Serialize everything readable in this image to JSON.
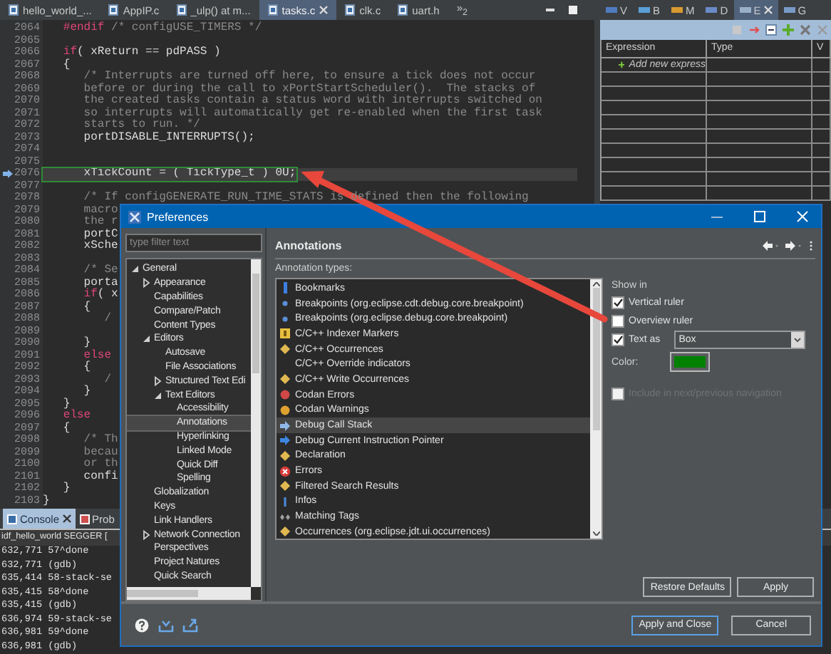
{
  "editor": {
    "tabs": [
      {
        "label": "hello_world_...",
        "selected": false
      },
      {
        "label": "AppIP.c",
        "selected": false
      },
      {
        "label": "_ulp() at m...",
        "selected": false
      },
      {
        "label": "tasks.c",
        "selected": true
      },
      {
        "label": "clk.c",
        "selected": false
      },
      {
        "label": "uart.h",
        "selected": false
      }
    ],
    "overflow": "»$_{2}$",
    "lines": [
      {
        "number": "2064",
        "current": false,
        "segments": [
          {
            "kind": "keyword",
            "text": "   #endif"
          },
          {
            "kind": "comment",
            "text": " /* configUSE_TIMERS */"
          }
        ]
      },
      {
        "number": "2065",
        "current": false
      },
      {
        "number": "2066",
        "current": false,
        "segments": [
          {
            "kind": "keyword",
            "text": "   if"
          },
          {
            "kind": "code",
            "text": "( xReturn == pdPASS )"
          }
        ]
      },
      {
        "number": "2067",
        "current": false,
        "segments": [
          {
            "kind": "code",
            "text": "   {"
          }
        ]
      },
      {
        "number": "2068",
        "current": false,
        "segments": [
          {
            "kind": "comment",
            "text": "      /* Interrupts are turned off here, to ensure a tick does not occur"
          }
        ]
      },
      {
        "number": "2069",
        "current": false,
        "segments": [
          {
            "kind": "comment",
            "text": "      before or during the call to xPortStartScheduler().  The stacks of"
          }
        ]
      },
      {
        "number": "2070",
        "current": false,
        "segments": [
          {
            "kind": "comment",
            "text": "      the created tasks contain a status word with interrupts switched on"
          }
        ]
      },
      {
        "number": "2071",
        "current": false,
        "segments": [
          {
            "kind": "comment",
            "text": "      so interrupts will automatically get re-enabled when the first task"
          }
        ]
      },
      {
        "number": "2072",
        "current": false,
        "segments": [
          {
            "kind": "comment",
            "text": "      starts to run. */"
          }
        ]
      },
      {
        "number": "2073",
        "current": false,
        "segments": [
          {
            "kind": "code",
            "text": "      portDISABLE_INTERRUPTS();"
          }
        ]
      },
      {
        "number": "2074",
        "current": false
      },
      {
        "number": "2075",
        "current": false
      },
      {
        "number": "2076",
        "current": true,
        "segments": [
          {
            "kind": "code",
            "text": "      xTickCount = ( TickType_t ) 0U;"
          }
        ]
      },
      {
        "number": "2077",
        "current": false
      },
      {
        "number": "2078",
        "current": false,
        "segments": [
          {
            "kind": "comment",
            "text": "      /* If configGENERATE_RUN_TIME_STATS is defined then the following"
          }
        ]
      },
      {
        "number": "2079",
        "current": false,
        "segments": [
          {
            "kind": "comment",
            "text": "      macro"
          }
        ]
      },
      {
        "number": "2080",
        "current": false,
        "segments": [
          {
            "kind": "comment",
            "text": "      the r"
          }
        ]
      },
      {
        "number": "2081",
        "current": false,
        "segments": [
          {
            "kind": "code",
            "text": "      portC"
          }
        ]
      },
      {
        "number": "2082",
        "current": false,
        "segments": [
          {
            "kind": "code",
            "text": "      xSche"
          }
        ]
      },
      {
        "number": "2083",
        "current": false
      },
      {
        "number": "2084",
        "current": false,
        "segments": [
          {
            "kind": "comment",
            "text": "      /* Se"
          }
        ]
      },
      {
        "number": "2085",
        "current": false,
        "segments": [
          {
            "kind": "code",
            "text": "      porta"
          }
        ]
      },
      {
        "number": "2086",
        "current": false,
        "segments": [
          {
            "kind": "keyword",
            "text": "      if"
          },
          {
            "kind": "code",
            "text": "( x"
          }
        ]
      },
      {
        "number": "2087",
        "current": false,
        "segments": [
          {
            "kind": "code",
            "text": "      {"
          }
        ]
      },
      {
        "number": "2088",
        "current": false,
        "segments": [
          {
            "kind": "comment",
            "text": "         /"
          }
        ]
      },
      {
        "number": "2089",
        "current": false
      },
      {
        "number": "2090",
        "current": false,
        "segments": [
          {
            "kind": "code",
            "text": "      }"
          }
        ]
      },
      {
        "number": "2091",
        "current": false,
        "segments": [
          {
            "kind": "keyword",
            "text": "      else"
          }
        ]
      },
      {
        "number": "2092",
        "current": false,
        "segments": [
          {
            "kind": "code",
            "text": "      {"
          }
        ]
      },
      {
        "number": "2093",
        "current": false,
        "segments": [
          {
            "kind": "comment",
            "text": "         /"
          }
        ]
      },
      {
        "number": "2094",
        "current": false,
        "segments": [
          {
            "kind": "code",
            "text": "      }"
          }
        ]
      },
      {
        "number": "2095",
        "current": false,
        "segments": [
          {
            "kind": "code",
            "text": "   }"
          }
        ]
      },
      {
        "number": "2096",
        "current": false,
        "segments": [
          {
            "kind": "keyword",
            "text": "   else"
          }
        ]
      },
      {
        "number": "2097",
        "current": false,
        "segments": [
          {
            "kind": "code",
            "text": "   {"
          }
        ]
      },
      {
        "number": "2098",
        "current": false,
        "segments": [
          {
            "kind": "comment",
            "text": "      /* Th"
          }
        ]
      },
      {
        "number": "2099",
        "current": false,
        "segments": [
          {
            "kind": "comment",
            "text": "      becau"
          }
        ]
      },
      {
        "number": "2100",
        "current": false,
        "segments": [
          {
            "kind": "comment",
            "text": "      or th"
          }
        ]
      },
      {
        "number": "2101",
        "current": false,
        "segments": [
          {
            "kind": "code",
            "text": "      confi"
          }
        ]
      },
      {
        "number": "2102",
        "current": false,
        "segments": [
          {
            "kind": "code",
            "text": "   }"
          }
        ]
      },
      {
        "number": "2103",
        "current": false,
        "segments": [
          {
            "kind": "code",
            "text": "}"
          }
        ]
      }
    ]
  },
  "watch": {
    "tabs": [
      {
        "label": "V",
        "selected": false
      },
      {
        "label": "B",
        "selected": false
      },
      {
        "label": "M",
        "selected": false
      },
      {
        "label": "D",
        "selected": false
      },
      {
        "label": "E",
        "selected": true
      },
      {
        "label": "G",
        "selected": false
      }
    ],
    "columns": [
      "Expression",
      "Type",
      "V"
    ],
    "add_row": "Add new express"
  },
  "console": {
    "tabs": [
      {
        "label": "Console",
        "selected": true
      },
      {
        "label": "Prob",
        "selected": false
      }
    ],
    "launch": "idf_hello_world SEGGER [",
    "lines": [
      "632,771 57^done",
      "632,771 (gdb)",
      "635,414 58-stack-se",
      "635,415 58^done",
      "635,415 (gdb)",
      "636,974 59-stack-se",
      "636,981 59^done",
      "636,981 (gdb)"
    ]
  },
  "dialog": {
    "title": "Preferences",
    "filter": {
      "placeholder": "type filter text"
    },
    "tree": [
      {
        "label": "General",
        "expanded": true,
        "selected": false,
        "children": [
          {
            "label": "Appearance",
            "expanded": false,
            "selected": false
          },
          {
            "label": "Capabilities",
            "selected": false
          },
          {
            "label": "Compare/Patch",
            "selected": false
          },
          {
            "label": "Content Types",
            "selected": false
          },
          {
            "label": "Editors",
            "expanded": true,
            "selected": false,
            "children": [
              {
                "label": "Autosave",
                "selected": false
              },
              {
                "label": "File Associations",
                "selected": false
              },
              {
                "label": "Structured Text Edi",
                "expanded": false,
                "selected": false
              },
              {
                "label": "Text Editors",
                "expanded": true,
                "selected": false,
                "children": [
                  {
                    "label": "Accessibility",
                    "selected": false
                  },
                  {
                    "label": "Annotations",
                    "selected": true
                  },
                  {
                    "label": "Hyperlinking",
                    "selected": false
                  },
                  {
                    "label": "Linked Mode",
                    "selected": false
                  },
                  {
                    "label": "Quick Diff",
                    "selected": false
                  },
                  {
                    "label": "Spelling",
                    "selected": false
                  }
                ]
              }
            ]
          },
          {
            "label": "Globalization",
            "selected": false
          },
          {
            "label": "Keys",
            "selected": false
          },
          {
            "label": "Link Handlers",
            "selected": false
          },
          {
            "label": "Network Connection",
            "expanded": false,
            "selected": false
          },
          {
            "label": "Perspectives",
            "selected": false
          },
          {
            "label": "Project Natures",
            "selected": false
          },
          {
            "label": "Quick Search",
            "selected": false
          }
        ]
      }
    ],
    "page_title": "Annotations",
    "types_label": "Annotation types:",
    "types": [
      {
        "label": "Bookmarks",
        "kind": "bookmark",
        "selected": false
      },
      {
        "label": "Breakpoints (org.eclipse.cdt.debug.core.breakpoint)",
        "kind": "breakpoint",
        "selected": false
      },
      {
        "label": "Breakpoints (org.eclipse.debug.core.breakpoint)",
        "kind": "breakpoint",
        "selected": false
      },
      {
        "label": "C/C++ Indexer Markers",
        "kind": "marker",
        "selected": false
      },
      {
        "label": "C/C++ Occurrences",
        "kind": "highlight",
        "selected": false
      },
      {
        "label": "C/C++ Override indicators",
        "kind": "plain",
        "selected": false
      },
      {
        "label": "C/C++ Write Occurrences",
        "kind": "highlight",
        "selected": false
      },
      {
        "label": "Codan Errors",
        "kind": "problem",
        "selected": false
      },
      {
        "label": "Codan Warnings",
        "kind": "caution",
        "selected": false
      },
      {
        "label": "Debug Call Stack",
        "kind": "stack",
        "selected": true
      },
      {
        "label": "Debug Current Instruction Pointer",
        "kind": "pointer",
        "selected": false
      },
      {
        "label": "Declaration",
        "kind": "highlight",
        "selected": false
      },
      {
        "label": "Errors",
        "kind": "error",
        "selected": false
      },
      {
        "label": "Filtered Search Results",
        "kind": "highlight",
        "selected": false
      },
      {
        "label": "Infos",
        "kind": "info",
        "selected": false
      },
      {
        "label": "Matching Tags",
        "kind": "tags",
        "selected": false
      },
      {
        "label": "Occurrences (org.eclipse.jdt.ui.occurrences)",
        "kind": "highlight",
        "selected": false
      }
    ],
    "show_in_label": "Show in",
    "options": [
      {
        "label": "Vertical ruler",
        "checked": true
      },
      {
        "label": "Overview ruler",
        "checked": false
      },
      {
        "label": "Text as",
        "checked": true
      }
    ],
    "text_style": "Box",
    "color_label": "Color:",
    "color": "#008000",
    "navigation": {
      "label": "Include in next/previous navigation",
      "checked": false,
      "disabled": true
    },
    "buttons": {
      "restore": "Restore Defaults",
      "apply": "Apply",
      "apply_close": "Apply and Close",
      "cancel": "Cancel"
    }
  }
}
